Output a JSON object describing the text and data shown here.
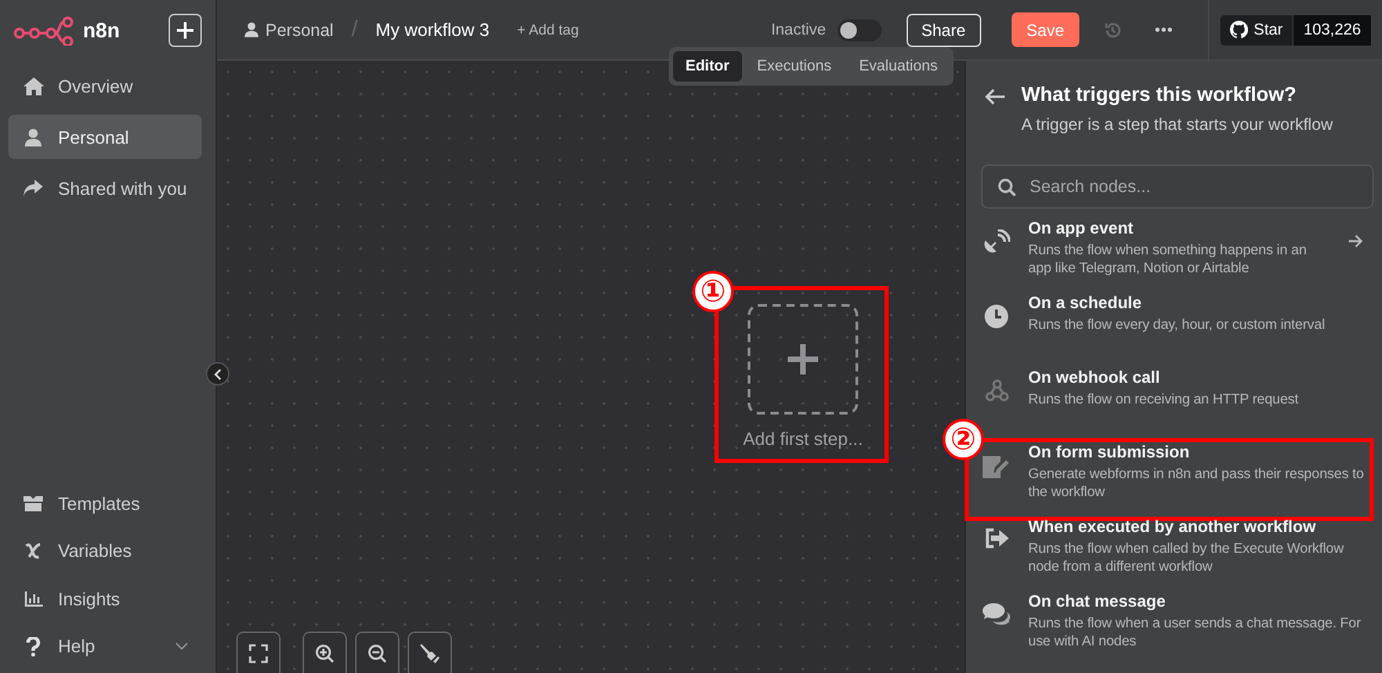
{
  "app": {
    "logo_text": "n8n"
  },
  "sidebar": {
    "top_items": [
      {
        "label": "Overview",
        "selected": false
      },
      {
        "label": "Personal",
        "selected": true
      },
      {
        "label": "Shared with you",
        "selected": false
      }
    ],
    "bottom_items": [
      {
        "label": "Templates",
        "kind": "link"
      },
      {
        "label": "Variables",
        "kind": "link"
      },
      {
        "label": "Insights",
        "kind": "link"
      },
      {
        "label": "Help",
        "kind": "submenu"
      }
    ]
  },
  "header": {
    "project": "Personal",
    "separator": "/",
    "workflow": "My workflow 3",
    "add_tag": "+ Add tag",
    "activation": {
      "label": "Inactive",
      "on": false
    },
    "share": "Share",
    "save": "Save",
    "github": {
      "star": "Star",
      "count": "103,226"
    }
  },
  "tabs": [
    {
      "label": "Editor",
      "selected": true
    },
    {
      "label": "Executions",
      "selected": false
    },
    {
      "label": "Evaluations",
      "selected": false
    }
  ],
  "canvas": {
    "add_first_step": "Add first step...",
    "callout": "①"
  },
  "panel": {
    "title": "What triggers this workflow?",
    "subtitle": "A trigger is a step that starts your workflow",
    "search": {
      "placeholder": "Search nodes..."
    },
    "items": [
      {
        "title": "On app event",
        "description": "Runs the flow when something happens in an app like Telegram, Notion or Airtable",
        "kind": "category"
      },
      {
        "title": "On a schedule",
        "description": "Runs the flow every day, hour, or custom interval",
        "kind": "trigger"
      },
      {
        "title": "On webhook call",
        "description": "Runs the flow on receiving an HTTP request",
        "kind": "trigger"
      },
      {
        "title": "On form submission",
        "description": "Generate webforms in n8n and pass their responses to the workflow",
        "kind": "trigger",
        "callout": "②"
      },
      {
        "title": "When executed by another workflow",
        "description": "Runs the flow when called by the Execute Workflow node from a different workflow",
        "kind": "trigger"
      },
      {
        "title": "On chat message",
        "description": "Runs the flow when a user sends a chat message. For use with AI nodes",
        "kind": "trigger"
      }
    ]
  }
}
